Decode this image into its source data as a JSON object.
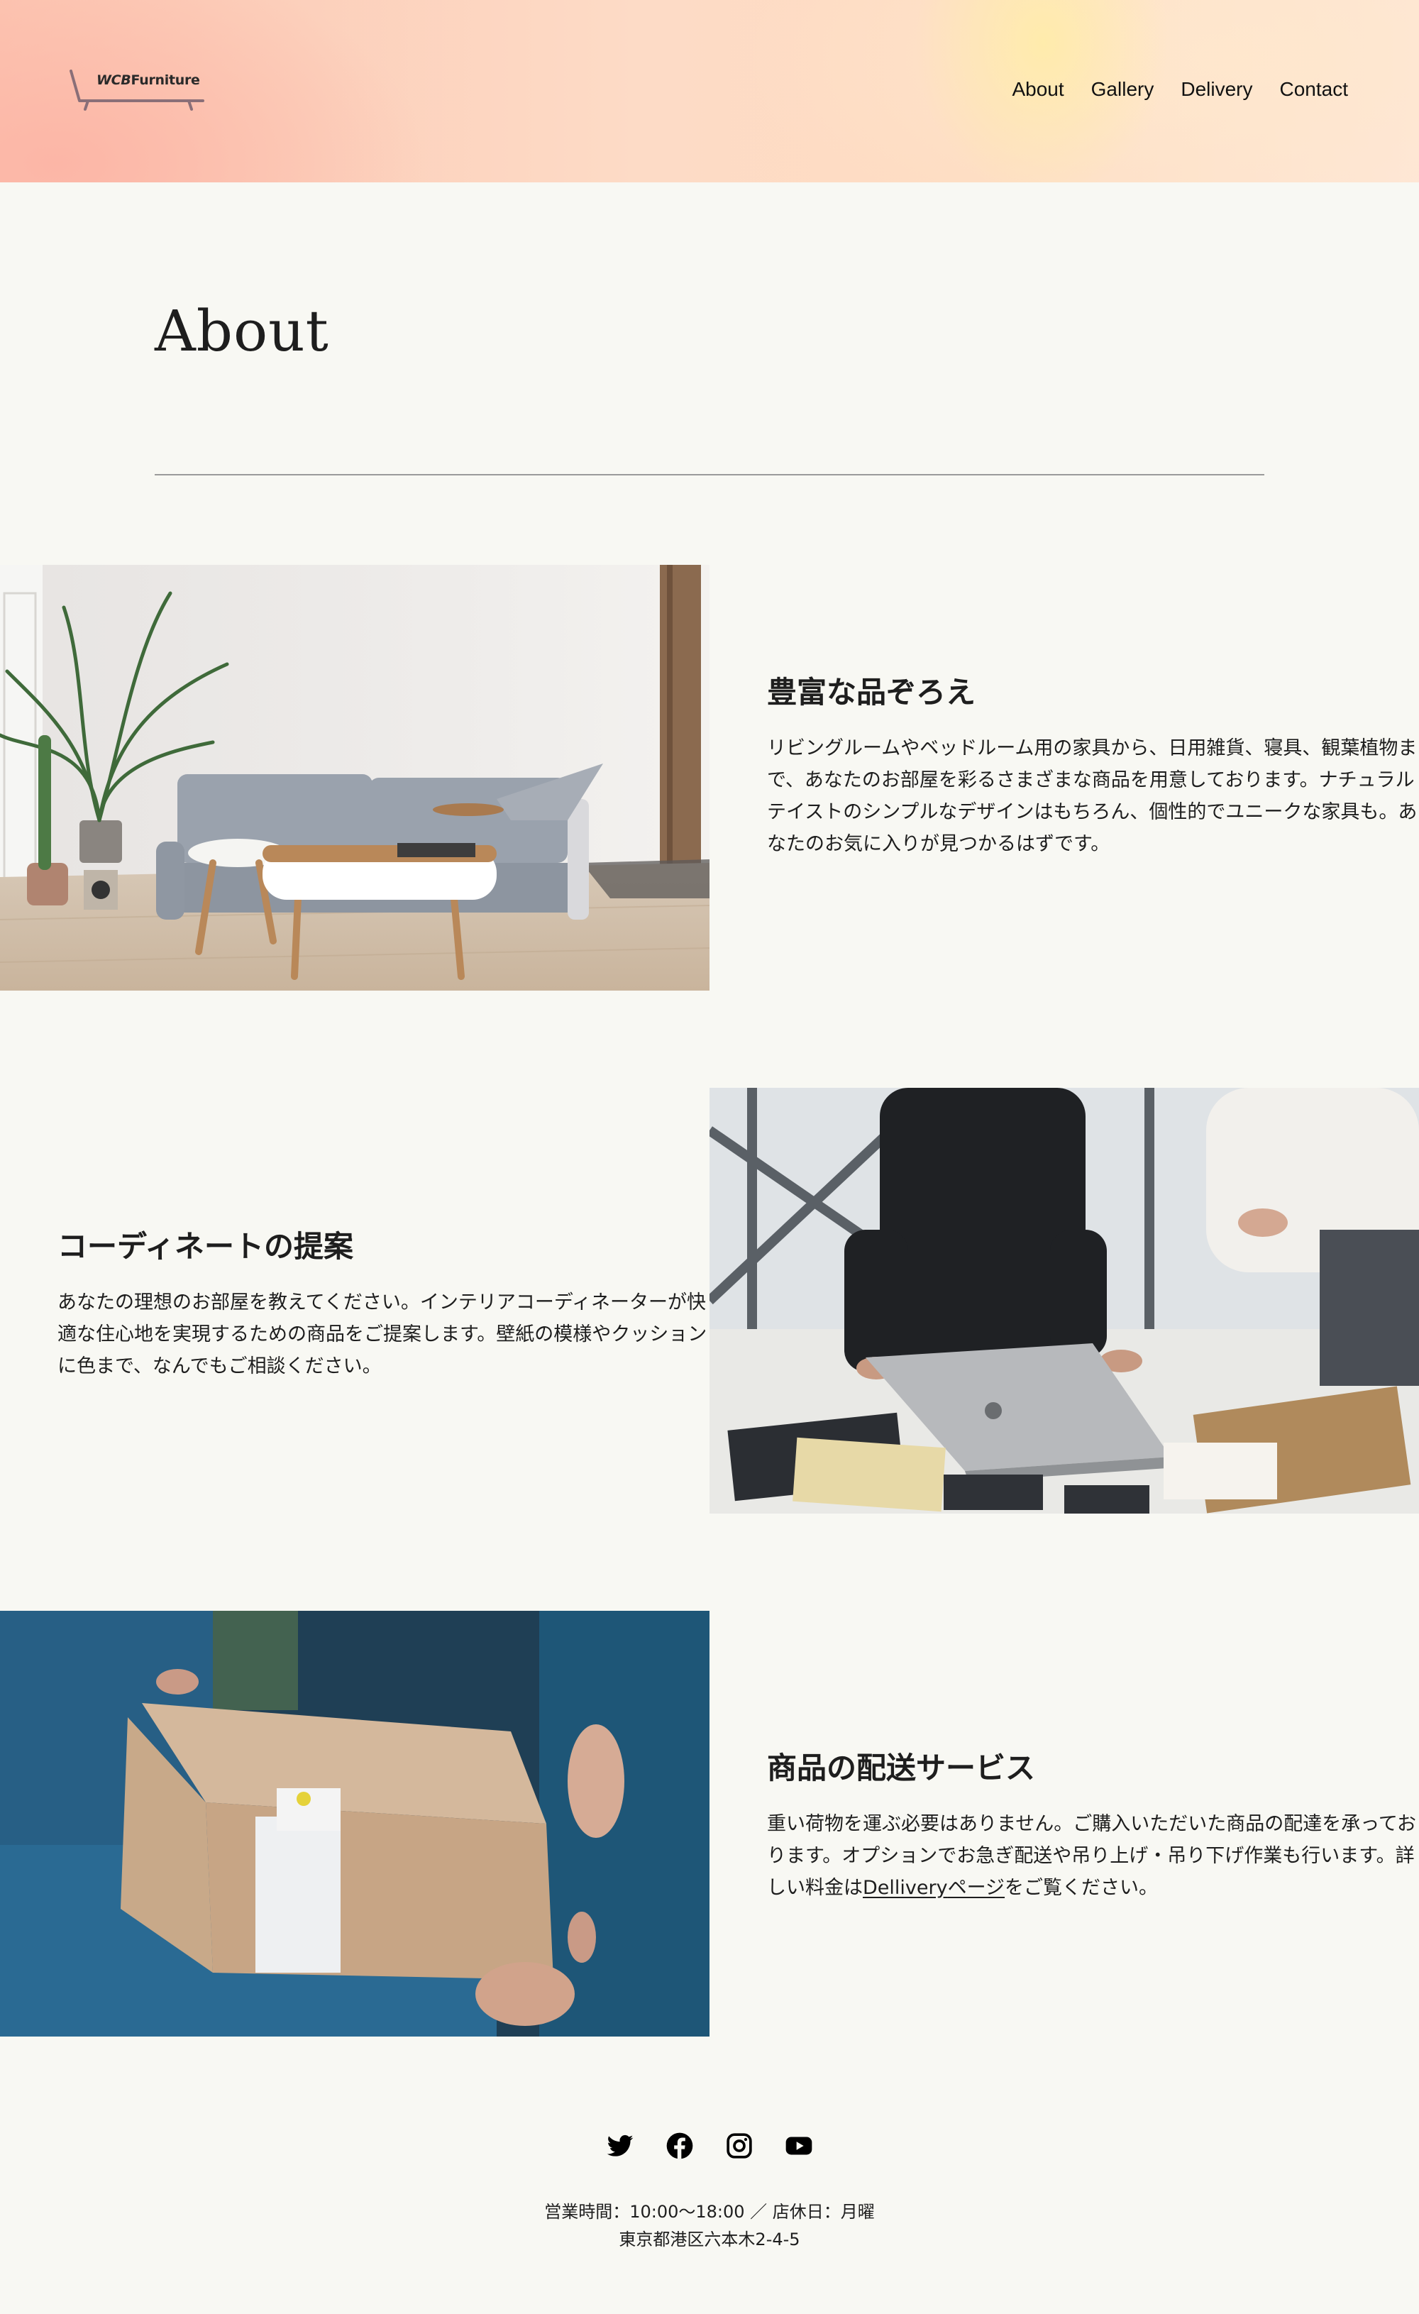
{
  "header": {
    "logo": {
      "mark": "WCB",
      "text": "Furniture"
    },
    "nav": [
      "About",
      "Gallery",
      "Delivery",
      "Contact"
    ]
  },
  "page": {
    "title": "About"
  },
  "sections": [
    {
      "image": "living-room-sofa-photo",
      "heading": "豊富な品ぞろえ",
      "body": "リビングルームやベッドルーム用の家具から、日用雑貨、寝具、観葉植物まで、あなたのお部屋を彩るさまざまな商品を用意しております。ナチュラルテイストのシンプルなデザインはもちろん、個性的でユニークな家具も。あなたのお気に入りが見つかるはずです。"
    },
    {
      "image": "interior-coordination-photo",
      "heading": "コーディネートの提案",
      "body": "あなたの理想のお部屋を教えてください。インテリアコーディネーターが快適な住心地を実現するための商品をご提案します。壁紙の模様やクッションに色まで、なんでもご相談ください。"
    },
    {
      "image": "package-delivery-photo",
      "heading": "商品の配送サービス",
      "body_before": "重い荷物を運ぶ必要はありません。ご購入いただいた商品の配達を承っております。オプションでお急ぎ配送や吊り上げ・吊り下げ作業も行います。詳しい料金は",
      "link": "Dellivery",
      "link_suffix": "ページ",
      "body_after": "をご覧ください。"
    }
  ],
  "footer": {
    "social": [
      "twitter-icon",
      "facebook-icon",
      "instagram-icon",
      "youtube-icon"
    ],
    "hours": "営業時間：10:00〜18:00 ／ 店休日：月曜",
    "address": "東京都港区六本木2-4-5"
  },
  "colors": {
    "background": "#f8f8f3",
    "text": "#1e1e1e"
  }
}
